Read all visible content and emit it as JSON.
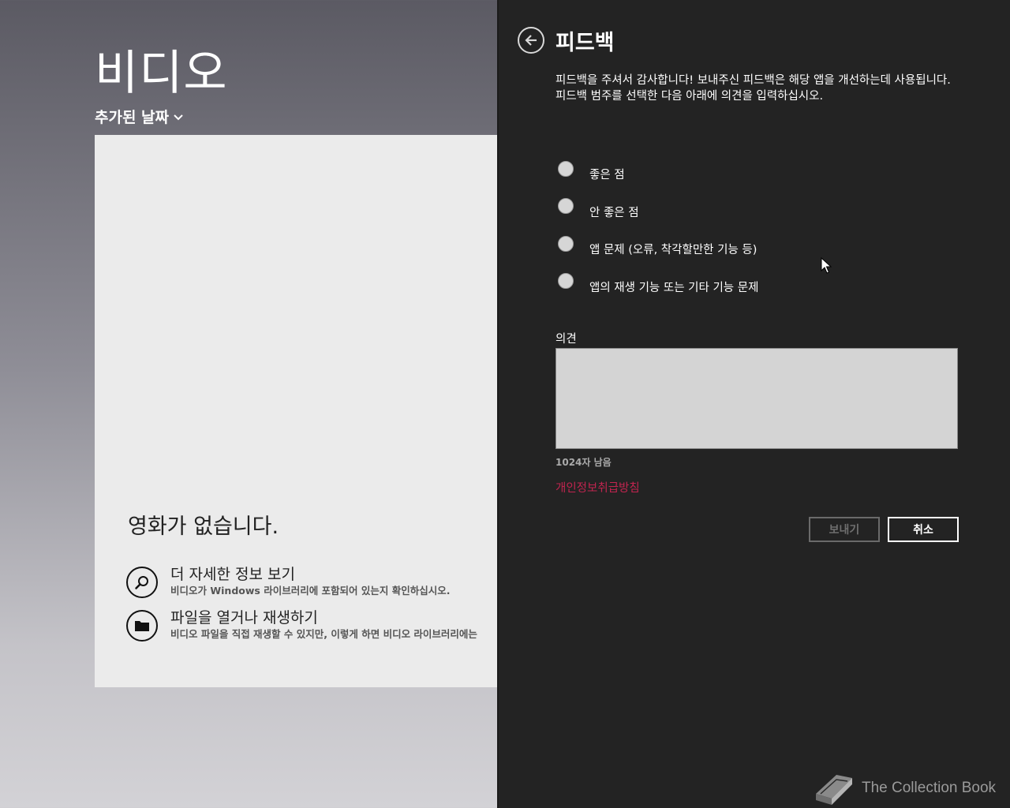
{
  "app": {
    "title": "비디오",
    "sort_label": "추가된 날짜"
  },
  "empty_state": {
    "title": "영화가 없습니다.",
    "actions": [
      {
        "title": "더 자세한 정보 보기",
        "subtitle": "비디오가 Windows 라이브러리에 포함되어 있는지 확인하십시오.",
        "icon": "search-icon"
      },
      {
        "title": "파일을 열거나 재생하기",
        "subtitle": "비디오 파일을 직접 재생할 수 있지만, 이렇게 하면 비디오 라이브러리에는",
        "icon": "folder-icon"
      }
    ]
  },
  "feedback": {
    "title": "피드백",
    "intro_line1": "피드백을 주셔서 감사합니다! 보내주신 피드백은 해당 앱을 개선하는데 사용됩니다.",
    "intro_line2": "피드백 범주를 선택한 다음 아래에 의견을 입력하십시오.",
    "categories": [
      "좋은 점",
      "안 좋은 점",
      "앱 문제 (오류, 착각할만한 기능 등)",
      "앱의 재생 기능 또는 기타 기능 문제"
    ],
    "comment_label": "의견",
    "comment_value": "",
    "char_count": "1024자 남음",
    "privacy_link": "개인정보취급방침",
    "send_label": "보내기",
    "cancel_label": "취소"
  },
  "watermark": {
    "text": "The Collection Book",
    "icon": "book-icon"
  },
  "colors": {
    "flyout_bg": "#232323",
    "privacy_link": "#c2244f",
    "panel_bg": "#ebebeb",
    "comment_bg": "#d4d4d4"
  }
}
